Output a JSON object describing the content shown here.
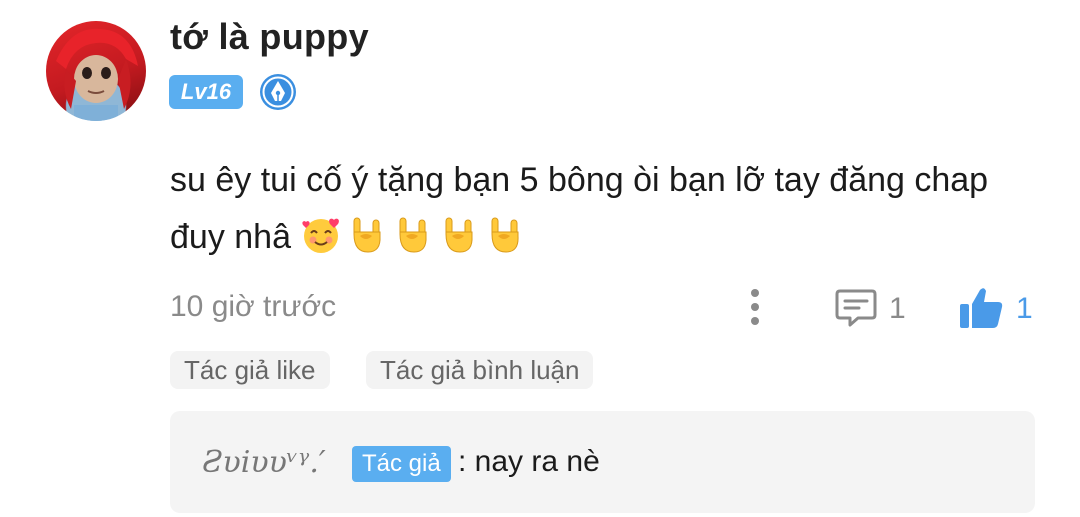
{
  "comment": {
    "username": "tớ là puppy",
    "level": "Lv16",
    "text": "su êy tui cố ý tặng  bạn 5 bông òi bạn lỡ tay đăng chap đuy nhâ",
    "emojis": [
      "smiling-face-with-hearts-icon",
      "sign-of-horns-icon",
      "sign-of-horns-icon",
      "sign-of-horns-icon",
      "sign-of-horns-icon"
    ],
    "timestamp": "10 giờ trước",
    "reply_count": "1",
    "like_count": "1",
    "tags": {
      "author_like": "Tác giả like",
      "author_reply": "Tác giả bình luận"
    },
    "reply": {
      "author": "Ƨυiυυᵛᵞ.′",
      "badge": "Tác giả",
      "text": ": nay ra nè"
    }
  },
  "colors": {
    "accent": "#5aaef0",
    "like": "#4a9ae8",
    "muted": "#8a8a8a",
    "panel": "#f4f4f4"
  }
}
